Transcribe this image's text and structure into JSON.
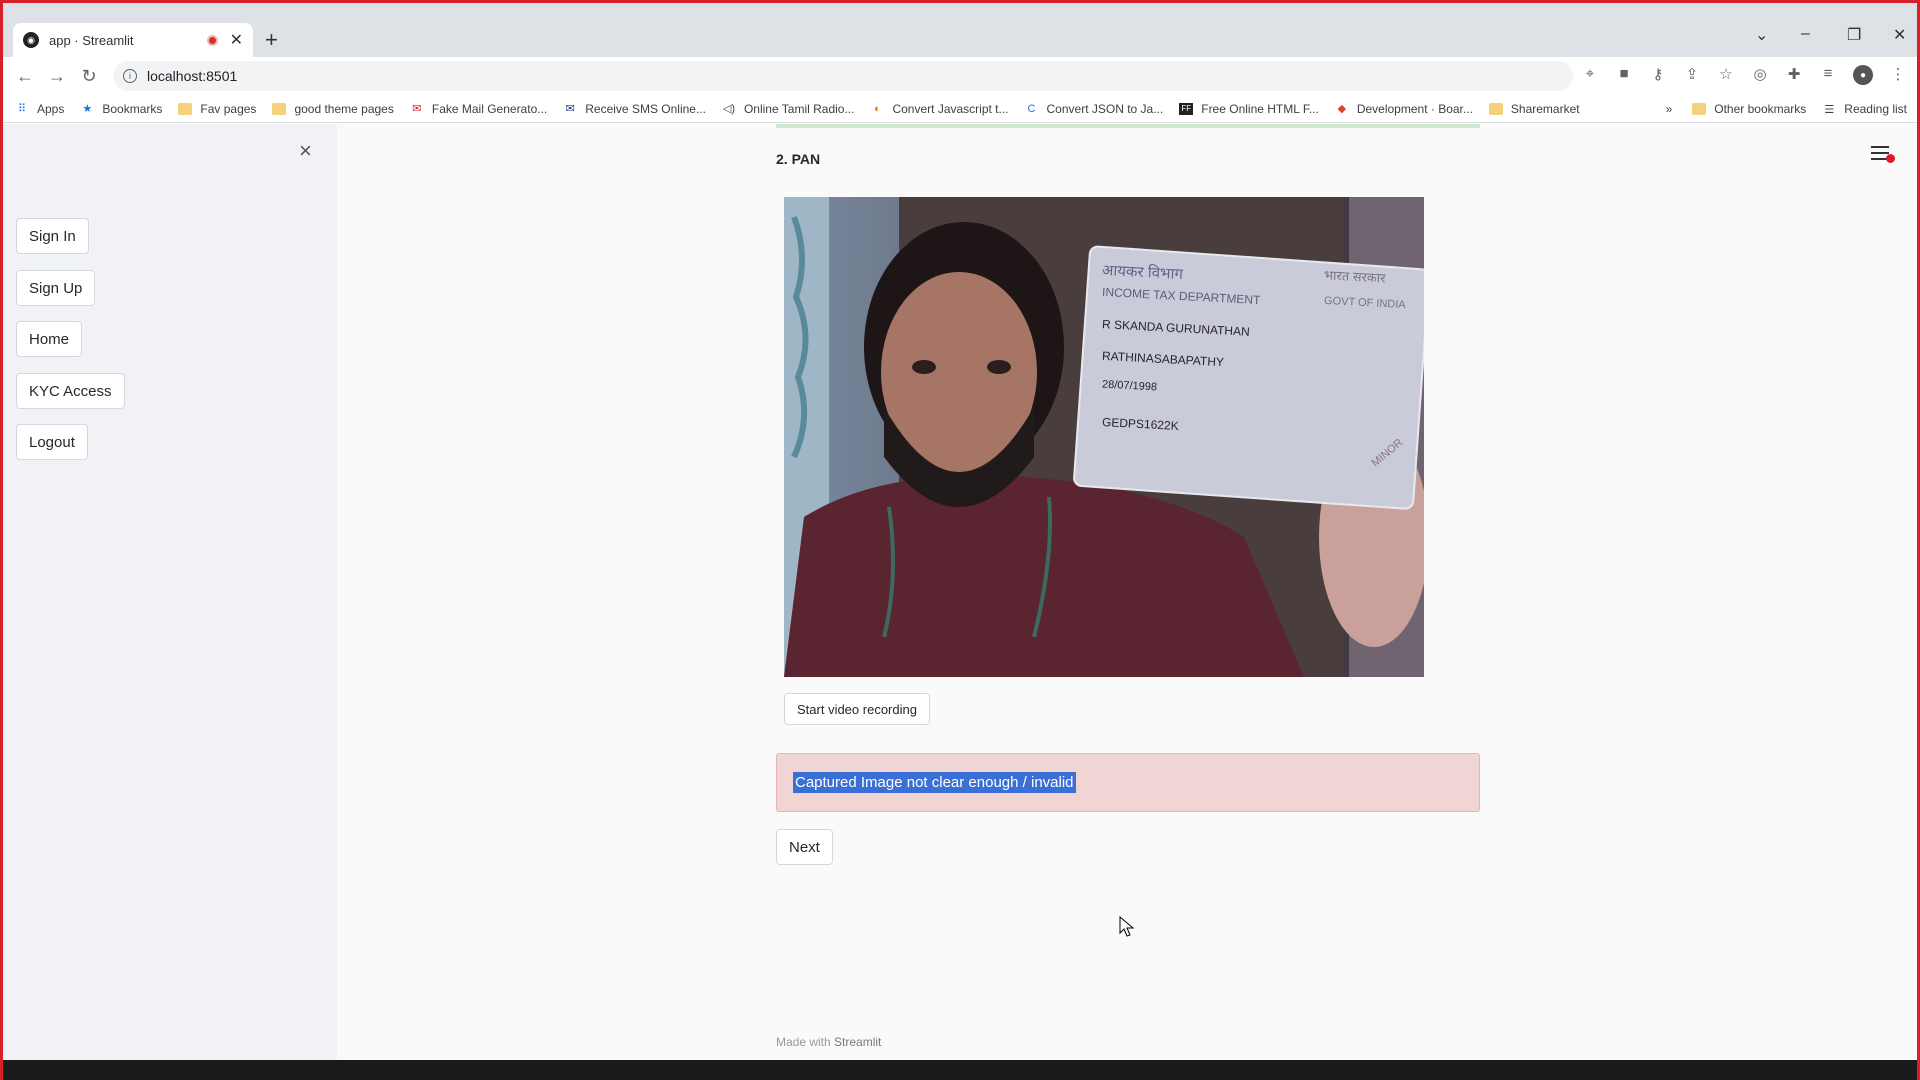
{
  "browser": {
    "tab_title": "app · Streamlit",
    "url": "localhost:8501",
    "bookmarks": [
      {
        "label": "Apps",
        "icon": "apps-grid-icon"
      },
      {
        "label": "Bookmarks",
        "icon": "star-icon"
      },
      {
        "label": "Fav pages",
        "icon": "folder-icon"
      },
      {
        "label": "good theme pages",
        "icon": "folder-icon"
      },
      {
        "label": "Fake Mail Generato...",
        "icon": "mail-icon"
      },
      {
        "label": "Receive SMS Online...",
        "icon": "mail-icon"
      },
      {
        "label": "Online Tamil Radio...",
        "icon": "speaker-icon"
      },
      {
        "label": "Convert Javascript t...",
        "icon": "site-icon"
      },
      {
        "label": "Convert JSON to Ja...",
        "icon": "site-icon"
      },
      {
        "label": "Free Online HTML F...",
        "icon": "site-icon"
      },
      {
        "label": "Development · Boar...",
        "icon": "gitlab-icon"
      },
      {
        "label": "Sharemarket",
        "icon": "folder-icon"
      }
    ],
    "overflow": "»",
    "other_bookmarks": "Other bookmarks",
    "reading_list": "Reading list"
  },
  "sidebar": {
    "close_icon": "×",
    "items": [
      {
        "label": "Sign In"
      },
      {
        "label": "Sign Up"
      },
      {
        "label": "Home"
      },
      {
        "label": "KYC Access"
      },
      {
        "label": "Logout"
      }
    ]
  },
  "main": {
    "section_title": "2. PAN",
    "camera_card_text": {
      "line1": "आयकर विभाग",
      "line2": "INCOME TAX DEPARTMENT",
      "line3": "भारत सरकार",
      "line4": "GOVT OF INDIA",
      "name": "R SKANDA GURUNATHAN",
      "father": "RATHINASABAPATHY",
      "dob": "28/07/1998",
      "number": "GEDPS1622K",
      "minor": "MINOR"
    },
    "record_button": "Start video recording",
    "error_message": "Captured Image not clear enough / invalid",
    "next_button": "Next",
    "footer_prefix": "Made with",
    "footer_brand": "Streamlit"
  },
  "colors": {
    "sidebar_bg": "#f0f2f6",
    "error_bg": "#f1d4d4",
    "selection": "#3a6fd6",
    "frame_border": "#d8202a"
  }
}
